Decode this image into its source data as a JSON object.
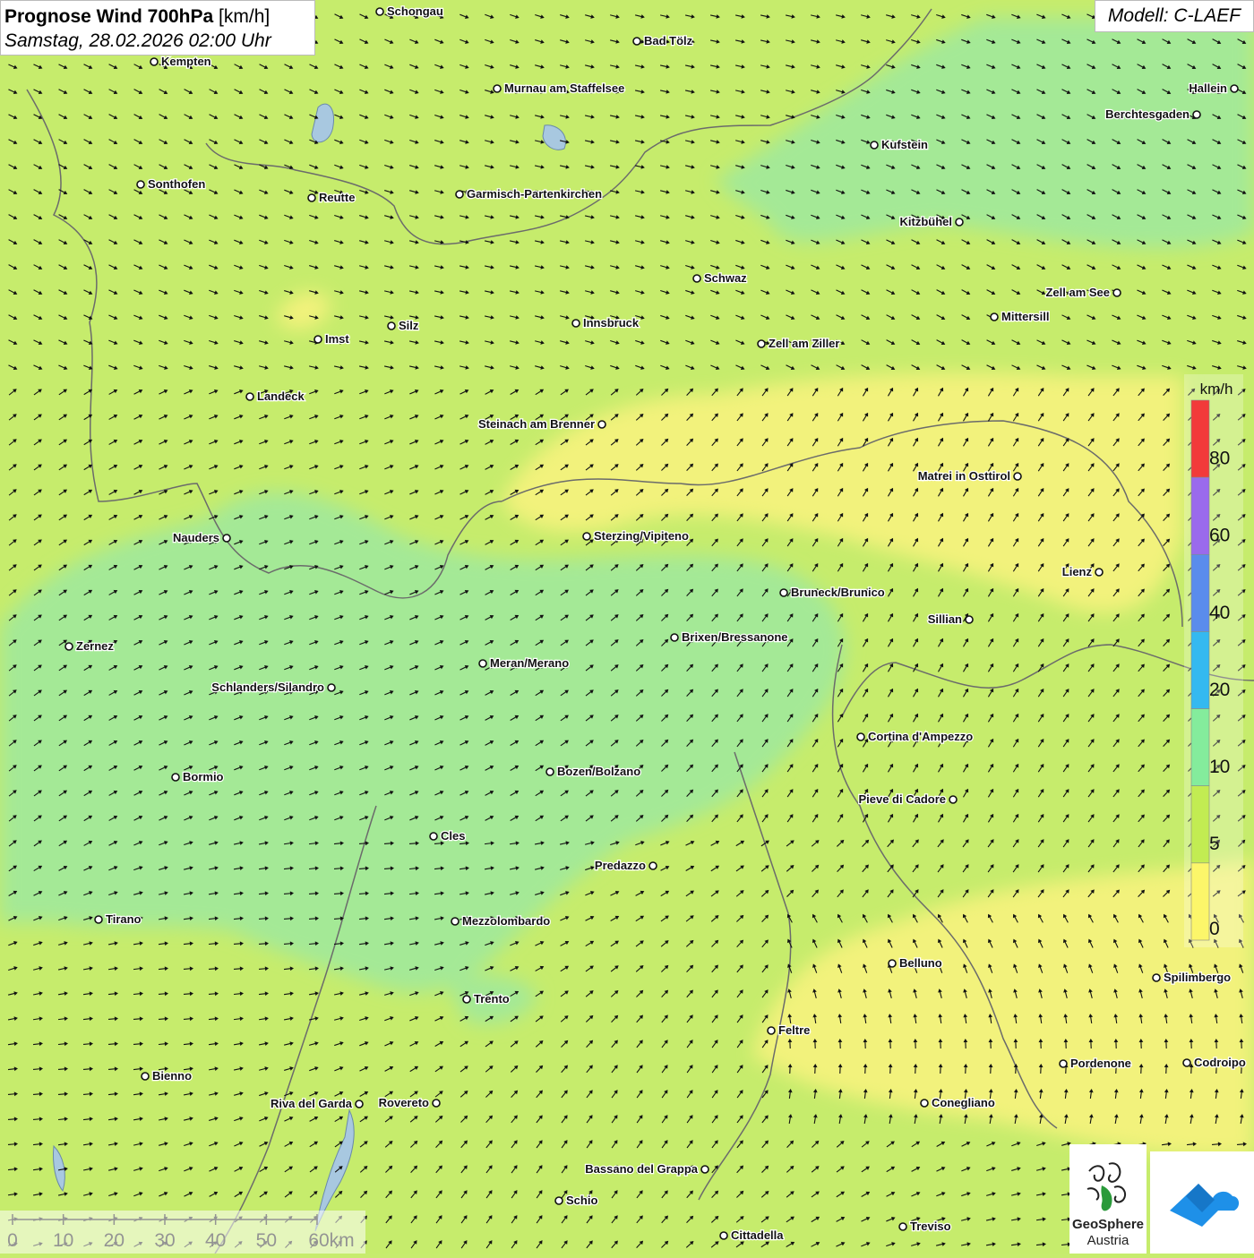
{
  "title": {
    "main_bold": "Prognose Wind 700hPa",
    "main_unit": "[km/h]",
    "datetime": "Samstag, 28.02.2026 02:00 Uhr"
  },
  "model": "Modell: C-LAEF",
  "legend": {
    "unit": "km/h",
    "labels": [
      "80",
      "60",
      "40",
      "20",
      "10",
      "5",
      "0"
    ],
    "colors": [
      "#f23a3a",
      "#9a6aec",
      "#5a8cec",
      "#34b9f0",
      "#84ec9c",
      "#c2ec52",
      "#fcf66a"
    ]
  },
  "scale": {
    "labels": [
      "0",
      "10",
      "20",
      "30",
      "40",
      "50",
      "60km"
    ]
  },
  "branding": {
    "org_line1": "GeoSphere",
    "org_line2": "Austria"
  },
  "cities": [
    {
      "name": "Schongau"
    },
    {
      "name": "Bad Tölz"
    },
    {
      "name": "Kempten"
    },
    {
      "name": "Murnau am Staffelsee"
    },
    {
      "name": "Hallein"
    },
    {
      "name": "Berchtesgaden"
    },
    {
      "name": "Kufstein"
    },
    {
      "name": "Sonthofen"
    },
    {
      "name": "Reutte"
    },
    {
      "name": "Garmisch-Partenkirchen"
    },
    {
      "name": "Kitzbühel"
    },
    {
      "name": "Schwaz"
    },
    {
      "name": "Zell am See"
    },
    {
      "name": "Mittersill"
    },
    {
      "name": "Imst"
    },
    {
      "name": "Silz"
    },
    {
      "name": "Innsbruck"
    },
    {
      "name": "Zell am Ziller"
    },
    {
      "name": "Landeck"
    },
    {
      "name": "Steinach am Brenner"
    },
    {
      "name": "Matrei in Osttirol"
    },
    {
      "name": "Nauders"
    },
    {
      "name": "Sterzing/Vipiteno"
    },
    {
      "name": "Lienz"
    },
    {
      "name": "Bruneck/Brunico"
    },
    {
      "name": "Sillian"
    },
    {
      "name": "Zernez"
    },
    {
      "name": "Brixen/Bressanone"
    },
    {
      "name": "Meran/Merano"
    },
    {
      "name": "Schlanders/Silandro"
    },
    {
      "name": "Cortina d'Ampezzo"
    },
    {
      "name": "Bormio"
    },
    {
      "name": "Bozen/Bolzano"
    },
    {
      "name": "Pieve di Cadore"
    },
    {
      "name": "Cles"
    },
    {
      "name": "Predazzo"
    },
    {
      "name": "Tirano"
    },
    {
      "name": "Mezzolombardo"
    },
    {
      "name": "Belluno"
    },
    {
      "name": "Spilimbergo"
    },
    {
      "name": "Trento"
    },
    {
      "name": "Feltre"
    },
    {
      "name": "Pordenone"
    },
    {
      "name": "Codroipo"
    },
    {
      "name": "Bienno"
    },
    {
      "name": "Riva del Garda"
    },
    {
      "name": "Rovereto"
    },
    {
      "name": "Conegliano"
    },
    {
      "name": "Bassano del Grappa"
    },
    {
      "name": "Schio"
    },
    {
      "name": "Treviso"
    },
    {
      "name": "Cittadella"
    }
  ]
}
